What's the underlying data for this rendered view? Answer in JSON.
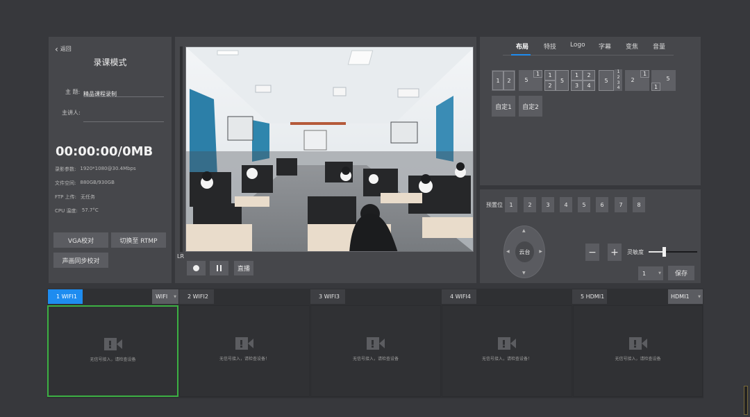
{
  "left": {
    "back": "返回",
    "title": "录课模式",
    "theme_label": "主 题:",
    "theme_value": "精品课程录制",
    "speaker_label": "主讲人:",
    "speaker_value": "",
    "timer": "00:00:00/0MB",
    "info": [
      {
        "label": "录影参数:",
        "value": "1920*1080@30.4Mbps"
      },
      {
        "label": "文件空间:",
        "value": "880GB/930GB"
      },
      {
        "label": "FTP 上传:",
        "value": "无任务"
      },
      {
        "label": "CPU 温度:",
        "value": "57.7°C"
      }
    ],
    "buttons": {
      "vga": "VGA校对",
      "rtmp": "切换至 RTMP",
      "sync": "声画同步校对"
    }
  },
  "preview": {
    "lr": "LR",
    "live_label": "直播"
  },
  "tabs": [
    "布局",
    "特技",
    "Logo",
    "字幕",
    "变焦",
    "音量"
  ],
  "layouts": {
    "custom1": "自定1",
    "custom2": "自定2",
    "l1": [
      "1",
      "2"
    ],
    "l2": [
      "5",
      "1"
    ],
    "l3": [
      "1",
      "2",
      "5"
    ],
    "l4": [
      "1",
      "2",
      "3",
      "4"
    ],
    "l5": [
      "5",
      "1",
      "2",
      "3",
      "4"
    ],
    "l6": [
      "2",
      "1"
    ],
    "l7": [
      "5",
      "1"
    ]
  },
  "ptz": {
    "preset_label": "预置位",
    "presets": [
      "1",
      "2",
      "3",
      "4",
      "5",
      "6",
      "7",
      "8"
    ],
    "center": "云台",
    "minus": "−",
    "plus": "+",
    "sensitivity_label": "灵敏度",
    "sensitivity_level": 0.3,
    "preset_select": "1",
    "save": "保存"
  },
  "channels": [
    {
      "tab": "1 WIFI1",
      "source": "WIFI",
      "message": "无信号接入，请检查设备",
      "active": true
    },
    {
      "tab": "2 WIFI2",
      "source": "",
      "message": "无信号接入，请检查设备！",
      "active": false
    },
    {
      "tab": "3 WIFI3",
      "source": "",
      "message": "无信号接入，请检查设备",
      "active": false
    },
    {
      "tab": "4 WIFI4",
      "source": "",
      "message": "无信号接入，请检查设备！",
      "active": false
    },
    {
      "tab": "5 HDMI1",
      "source": "HDMI1",
      "message": "无信号接入，请检查设备",
      "active": false
    }
  ],
  "colors": {
    "accent": "#1e8cf0",
    "active_border": "#3cb043",
    "panel": "#46474b",
    "background": "#37383c"
  }
}
